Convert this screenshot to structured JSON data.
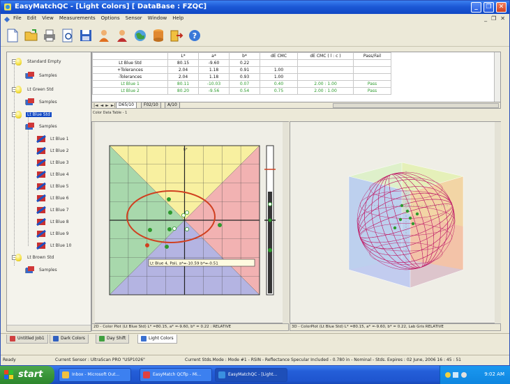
{
  "window": {
    "app_title": "EasyMatchQC - [Light Colors]   [ DataBase : FZQC]",
    "min_label": "_",
    "max_label": "❐",
    "close_label": "✕"
  },
  "menu": {
    "items": [
      "File",
      "Edit",
      "View",
      "Measurements",
      "Options",
      "Sensor",
      "Window",
      "Help"
    ],
    "mdi_min": "_",
    "mdi_max": "❐",
    "mdi_close": "✕"
  },
  "toolbar": {
    "buttons": [
      "new-icon",
      "open-icon",
      "print-icon",
      "print-preview-icon",
      "save-icon",
      "user-icon",
      "user-red-icon",
      "globe-icon",
      "database-icon",
      "export-icon",
      "help-icon"
    ]
  },
  "tree": {
    "nodes": [
      {
        "label": "Standard Empty",
        "kind": "standard"
      },
      {
        "label": "Samples",
        "kind": "samples"
      },
      {
        "label": "Lt Green Std",
        "kind": "standard"
      },
      {
        "label": "Samples",
        "kind": "samples"
      },
      {
        "label": "Lt Blue Std",
        "kind": "standard"
      },
      {
        "label": "Samples",
        "kind": "samples"
      },
      {
        "label": "Lt Blue 1",
        "kind": "sample"
      },
      {
        "label": "Lt Blue 2",
        "kind": "sample"
      },
      {
        "label": "Lt Blue 3",
        "kind": "sample"
      },
      {
        "label": "Lt Blue 4",
        "kind": "sample"
      },
      {
        "label": "Lt Blue 5",
        "kind": "sample"
      },
      {
        "label": "Lt Blue 6",
        "kind": "sample"
      },
      {
        "label": "Lt Blue 7",
        "kind": "sample"
      },
      {
        "label": "Lt Blue 8",
        "kind": "sample"
      },
      {
        "label": "Lt Blue 9",
        "kind": "sample"
      },
      {
        "label": "Lt Blue 10",
        "kind": "sample"
      },
      {
        "label": "Lt Brown Std",
        "kind": "standard"
      },
      {
        "label": "Samples",
        "kind": "samples"
      }
    ],
    "selected_index": 4
  },
  "table": {
    "headers": [
      "",
      "L*",
      "a*",
      "b*",
      "dE CMC",
      "dE CMC ( l : c )",
      "Pass/Fail"
    ],
    "rows": [
      {
        "cells": [
          "Lt Blue Std",
          "80.15",
          "-9.60",
          "0.22",
          "",
          "",
          ""
        ],
        "green": false
      },
      {
        "cells": [
          "+Tolerances",
          "2.04",
          "1.18",
          "0.91",
          "1.00",
          "",
          ""
        ],
        "green": false
      },
      {
        "cells": [
          "-Tolerances",
          "2.04",
          "1.18",
          "0.93",
          "1.00",
          "",
          ""
        ],
        "green": false
      },
      {
        "cells": [
          "Lt Blue 1",
          "80.11",
          "-10.03",
          "0.07",
          "0.40",
          "2.00 : 1.00",
          "Pass"
        ],
        "green": true
      },
      {
        "cells": [
          "Lt Blue 2",
          "80.20",
          "-9.56",
          "0.54",
          "0.75",
          "2.00 : 1.00",
          "Pass"
        ],
        "green": true
      }
    ],
    "nav": [
      "|◄",
      "◄",
      "►",
      "►|"
    ],
    "illuminant_tabs": [
      "D65/10",
      "F02/10",
      "A/10"
    ],
    "active_tab": 0
  },
  "caption": "Color Data Table - 1",
  "plot2d": {
    "tooltip": "Lt Blue 4, Pali, a*=-10.59 b*=-0.51",
    "axis_label": "b*",
    "footer": "2D - Color Plot (Lt Blue Std) L* =80.15, a* =-9.60, b* = 0.22    : RELATIVE",
    "colors": {
      "yellow": "#f8f0a0",
      "red": "#f2b2b2",
      "blue": "#b4b4e2",
      "green": "#a8d8ac",
      "ellipse": "#d04020",
      "point": "#2e9a2e"
    }
  },
  "plot3d": {
    "footer": "3D - ColorPlot (Lt Blue Std) L* =80.15, a* =-9.60, b* = 0.22, Lab Gris RELATIVE",
    "sphere_color": "#c0206a"
  },
  "bottom_tabs": [
    {
      "label": "Untitled Job1",
      "active": false
    },
    {
      "label": "Dark Colors",
      "active": false
    },
    {
      "label": "Day Shift",
      "active": false
    },
    {
      "label": "Light Colors",
      "active": true
    }
  ],
  "status": {
    "ready": "Ready",
    "sensor": "Current Sensor : UltraScan PRO \"USP1026\"",
    "mode": "Current Stds.Mode : Mode #1 - RSIN - Reflectance Specular Included - 0.780 in - Nominal - Stds. Expires : 02 June, 2006 16 : 45 : 51"
  },
  "taskbar": {
    "start_label": "start",
    "tasks": [
      {
        "label": "Inbox - Microsoft Out...",
        "active": false
      },
      {
        "label": "EasyMatch QCflp - Mi...",
        "active": false
      },
      {
        "label": "EasyMatchQC - [Light...",
        "active": true
      }
    ],
    "time": "9:02 AM"
  }
}
